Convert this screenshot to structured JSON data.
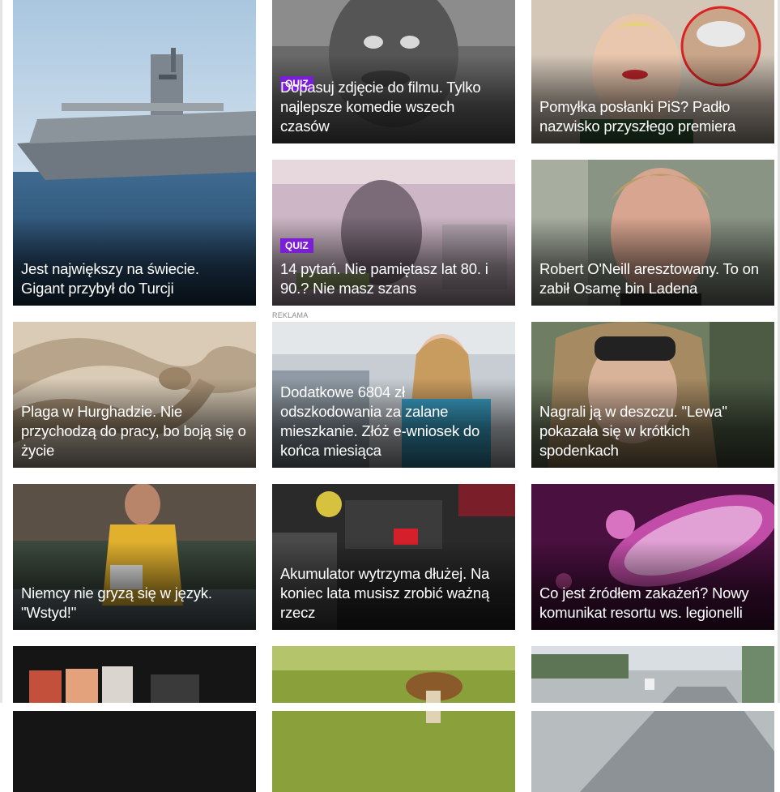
{
  "feed": {
    "ad_label": "REKLAMA",
    "badge_quiz": "QUIZ",
    "cards": [
      {
        "title": "Jest największy na świecie. Gigant przybył do Turcji",
        "image": "aircraft-carrier-photo"
      },
      {
        "title": "Dopasuj zdjęcie do filmu. Tylko najlepsze komedie wszech czasów",
        "badge": "QUIZ",
        "image": "black-and-white-film-still"
      },
      {
        "title": "Pomyłka posłanki PiS? Padło nazwisko przyszłego premiera",
        "image": "politicians-portrait"
      },
      {
        "title": "14 pytań. Nie pamiętasz lat 80. i 90.? Nie masz szans",
        "badge": "QUIZ",
        "image": "polish-banknote"
      },
      {
        "title": "Robert O'Neill aresztowany. To on zabił Osamę bin Ladena",
        "image": "man-portrait"
      },
      {
        "title": "Plaga w Hurghadzie. Nie przychodzą do pracy, bo boją się o życie",
        "image": "horned-viper-snake"
      },
      {
        "title": "Dodatkowe 6804 zł odszkodowania za zalane mieszkanie. Złóż e-wniosek do końca miesiąca",
        "image": "woman-leaking-ceiling"
      },
      {
        "title": "Nagrali ją w deszczu. \"Lewa\" pokazała się w krótkich spodenkach",
        "image": "woman-sunglasses-selfie"
      },
      {
        "title": "Niemcy nie gryzą się w język. \"Wstyd!\"",
        "image": "athlete-stadium"
      },
      {
        "title": "Akumulator wytrzyma dłużej. Na koniec lata musisz zrobić ważną rzecz",
        "image": "car-engine-battery"
      },
      {
        "title": "Co jest źródłem zakażeń? Nowy komunikat resortu ws. legionelli",
        "image": "bacteria-microscope"
      },
      {
        "title": "",
        "image": "gallery-screens"
      },
      {
        "title": "",
        "image": "mushroom-forest"
      },
      {
        "title": "",
        "image": "highway-road"
      }
    ]
  },
  "colors": {
    "quiz_badge": "#7a1fd6",
    "headline_text": "#ffffff",
    "page_bg": "#ffffff"
  }
}
